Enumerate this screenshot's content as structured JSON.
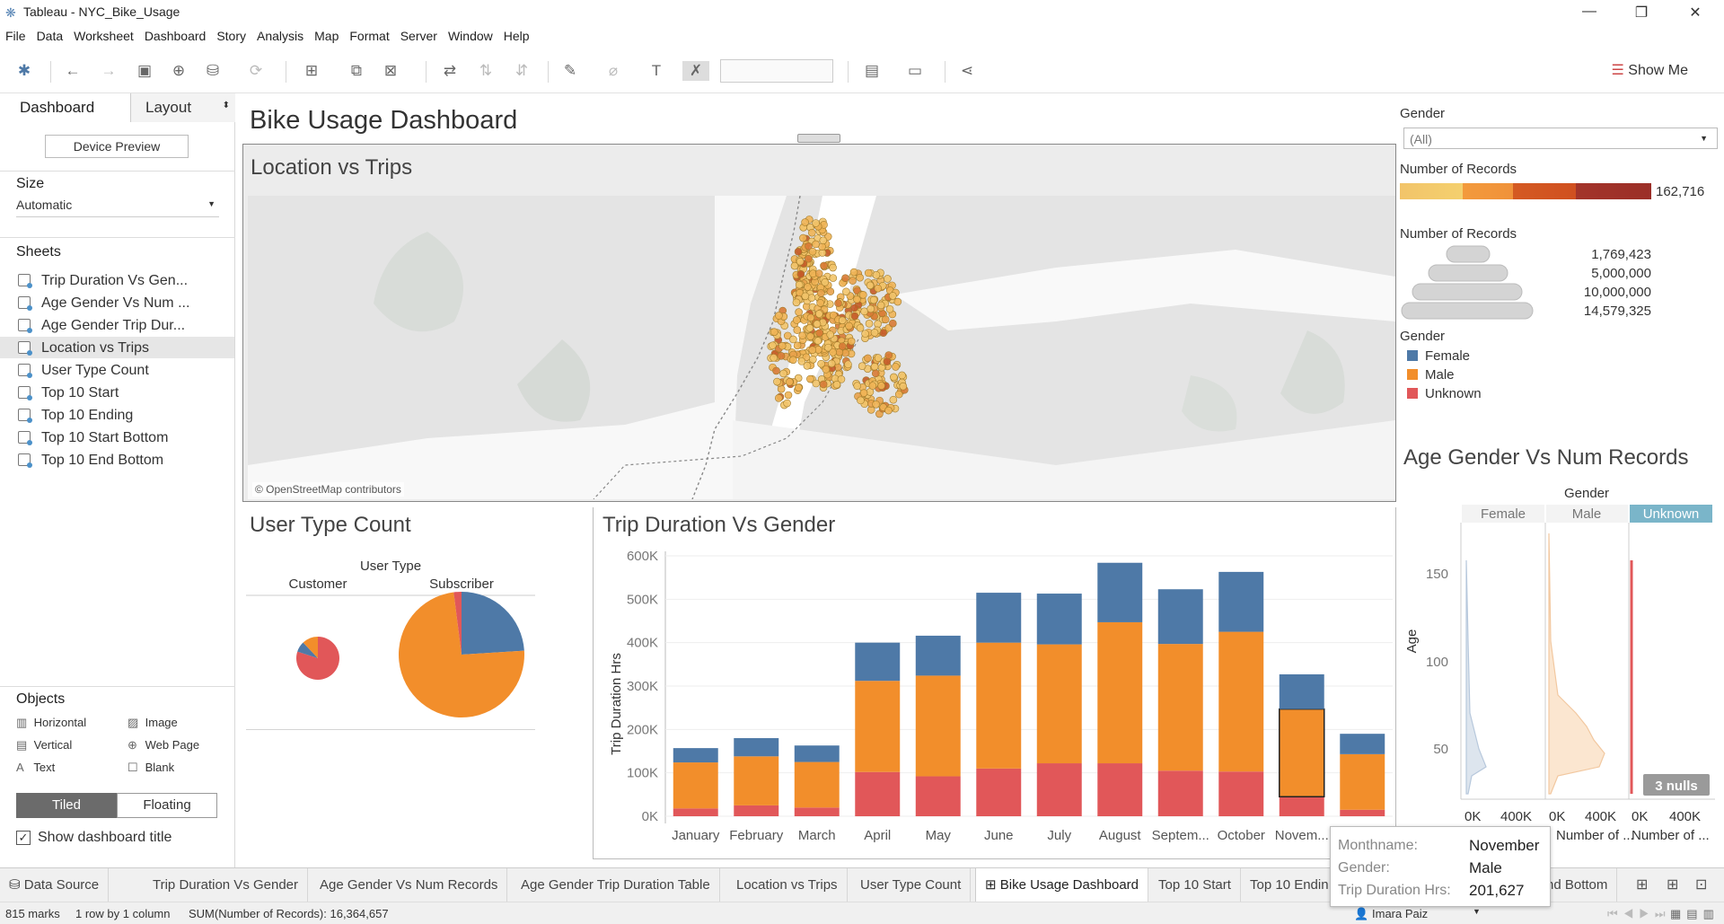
{
  "window": {
    "title": "Tableau - NYC_Bike_Usage",
    "minimize": "—",
    "restore": "❐",
    "close": "✕"
  },
  "menu": [
    "File",
    "Data",
    "Worksheet",
    "Dashboard",
    "Story",
    "Analysis",
    "Map",
    "Format",
    "Server",
    "Window",
    "Help"
  ],
  "toolbar": {
    "show_me": "Show Me"
  },
  "left_pane": {
    "tabs": {
      "dashboard": "Dashboard",
      "layout": "Layout"
    },
    "device_preview": "Device Preview",
    "size_heading": "Size",
    "size_value": "Automatic",
    "sheets_heading": "Sheets",
    "sheets": [
      {
        "label": "Trip Duration Vs Gen..."
      },
      {
        "label": "Age Gender Vs Num ..."
      },
      {
        "label": "Age Gender Trip Dur..."
      },
      {
        "label": "Location vs Trips"
      },
      {
        "label": "User Type Count"
      },
      {
        "label": "Top 10 Start"
      },
      {
        "label": "Top 10 Ending"
      },
      {
        "label": "Top 10 Start Bottom"
      },
      {
        "label": "Top 10 End Bottom"
      }
    ],
    "objects_heading": "Objects",
    "objects": {
      "horizontal": "Horizontal",
      "image": "Image",
      "vertical": "Vertical",
      "web_page": "Web Page",
      "text": "Text",
      "blank": "Blank"
    },
    "tiled": "Tiled",
    "floating": "Floating",
    "show_title": "Show dashboard title"
  },
  "dashboard": {
    "title": "Bike Usage Dashboard",
    "map_title": "Location vs Trips",
    "osm": "© OpenStreetMap contributors",
    "usertype_title": "User Type Count",
    "trip_title": "Trip Duration Vs Gender",
    "age_title": "Age Gender Vs Num Records"
  },
  "filters": {
    "gender_label": "Gender",
    "gender_value": "(All)",
    "records_label": "Number of Records",
    "records_max": "162,716",
    "size_label": "Number of Records",
    "size_values": [
      "1,769,423",
      "5,000,000",
      "10,000,000",
      "14,579,325"
    ],
    "gender_legend_label": "Gender",
    "genders": [
      "Female",
      "Male",
      "Unknown"
    ]
  },
  "colors": {
    "female": "#4e79a7",
    "male": "#f28e2b",
    "unknown": "#e15759",
    "accent": "#666666"
  },
  "chart_data": [
    {
      "type": "bar",
      "title": "Trip Duration Vs Gender",
      "ylabel": "Trip Duration Hrs",
      "ylim": [
        0,
        600000
      ],
      "yticks": [
        "0K",
        "100K",
        "200K",
        "300K",
        "400K",
        "500K",
        "600K"
      ],
      "categories": [
        "January",
        "February",
        "March",
        "April",
        "May",
        "June",
        "July",
        "August",
        "Septem...",
        "October",
        "Novem...",
        ""
      ],
      "series": [
        {
          "name": "Unknown",
          "values": [
            18000,
            25000,
            20000,
            102000,
            92000,
            110000,
            122000,
            122000,
            105000,
            103000,
            45000,
            15000
          ]
        },
        {
          "name": "Male",
          "values": [
            106000,
            113000,
            105000,
            210000,
            232000,
            290000,
            274000,
            325000,
            292000,
            322000,
            202000,
            128000
          ]
        },
        {
          "name": "Female",
          "values": [
            33000,
            42000,
            38000,
            88000,
            92000,
            115000,
            117000,
            137000,
            126000,
            138000,
            80000,
            47000
          ]
        }
      ],
      "highlight_index": 10
    },
    {
      "type": "pie",
      "title": "User Type Count",
      "header": "User Type",
      "categories": [
        "Customer",
        "Subscriber"
      ],
      "series": [
        {
          "name": "Customer",
          "values": [
            {
              "label": "Unknown",
              "value": 80
            },
            {
              "label": "Female",
              "value": 8
            },
            {
              "label": "Male",
              "value": 12
            }
          ]
        },
        {
          "name": "Subscriber",
          "values": [
            {
              "label": "Female",
              "value": 24
            },
            {
              "label": "Male",
              "value": 74
            },
            {
              "label": "Unknown",
              "value": 2
            }
          ]
        }
      ]
    },
    {
      "type": "area",
      "title": "Age Gender Vs Num Records",
      "header": "Gender",
      "columns": [
        "Female",
        "Male",
        "Unknown"
      ],
      "ylabel": "Age",
      "yticks": [
        "50",
        "100",
        "150"
      ],
      "xticks": [
        "0K",
        "400K"
      ],
      "xlabel": "Number of ...",
      "nulls": "3 nulls"
    }
  ],
  "tooltip": {
    "monthname_label": "Monthname:",
    "monthname_value": "November",
    "gender_label": "Gender:",
    "gender_value": "Male",
    "duration_label": "Trip Duration Hrs:",
    "duration_value": "201,627"
  },
  "bottom_tabs": [
    "Data Source",
    "Trip Duration Vs Gender",
    "Age Gender Vs Num Records",
    "Age Gender Trip Duration Table",
    "Location vs Trips",
    "User Type Count",
    "Bike Usage Dashboard",
    "Top 10 Start",
    "Top 10 Endin",
    "nd Bottom"
  ],
  "status": {
    "marks": "815 marks",
    "rows": "1 row by 1 column",
    "sum": "SUM(Number of Records): 16,364,657",
    "user": "Imara Paiz"
  }
}
